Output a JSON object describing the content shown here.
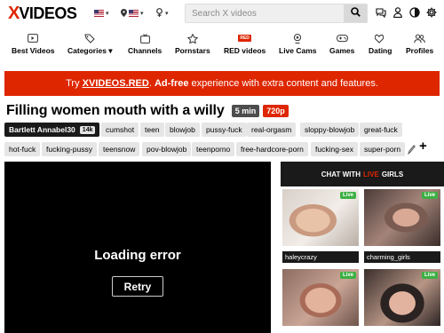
{
  "header": {
    "logo_x": "X",
    "logo_rest": "VIDEOS",
    "search_placeholder": "Search X videos",
    "icons": [
      "flag-us-icon",
      "location-icon",
      "gender-icon",
      "search-icon",
      "chat-icon",
      "user-icon",
      "contrast-icon",
      "gear-icon"
    ]
  },
  "nav": {
    "items": [
      {
        "label": "Best Videos",
        "icon": "play-icon"
      },
      {
        "label": "Categories ▾",
        "icon": "tag-icon"
      },
      {
        "label": "Channels",
        "icon": "tv-icon"
      },
      {
        "label": "Pornstars",
        "icon": "star-icon"
      },
      {
        "label": "RED videos",
        "icon": "red-icon"
      },
      {
        "label": "Live Cams",
        "icon": "webcam-icon"
      },
      {
        "label": "Games",
        "icon": "gamepad-icon"
      },
      {
        "label": "Dating",
        "icon": "hearts-icon"
      },
      {
        "label": "Profiles",
        "icon": "people-icon"
      }
    ]
  },
  "promo": {
    "pre": "Try ",
    "brand": "XVIDEOS.RED",
    "mid": ". ",
    "bold": "Ad-free",
    "post": " experience with extra content and features."
  },
  "video": {
    "title": "Filling women mouth with a willy",
    "duration": "5 min",
    "quality": "720p"
  },
  "tags": {
    "uploader": "Bartlett Annabel30",
    "uploader_count": "14k",
    "list": [
      "cumshot",
      "teen",
      "blowjob",
      "pussy-fuck",
      "real-orgasm",
      "sloppy-blowjob",
      "great-fuck",
      "hot-fuck",
      "fucking-pussy",
      "teensnow",
      "pov-blowjob",
      "teenporno",
      "free-hardcore-porn",
      "fucking-sex",
      "super-porn"
    ],
    "more": "+"
  },
  "player": {
    "error": "Loading error",
    "retry": "Retry"
  },
  "chat": {
    "head_pre": "CHAT WITH",
    "head_live": "LIVE",
    "head_post": "GIRLS",
    "live_badge": "Live",
    "cams": [
      {
        "name": "haleycrazy"
      },
      {
        "name": "charming_girls"
      },
      {
        "name": ""
      },
      {
        "name": ""
      }
    ]
  },
  "colors": {
    "brand_red": "#de2600",
    "live_green": "#3cb043",
    "dark": "#1a1a1a"
  }
}
